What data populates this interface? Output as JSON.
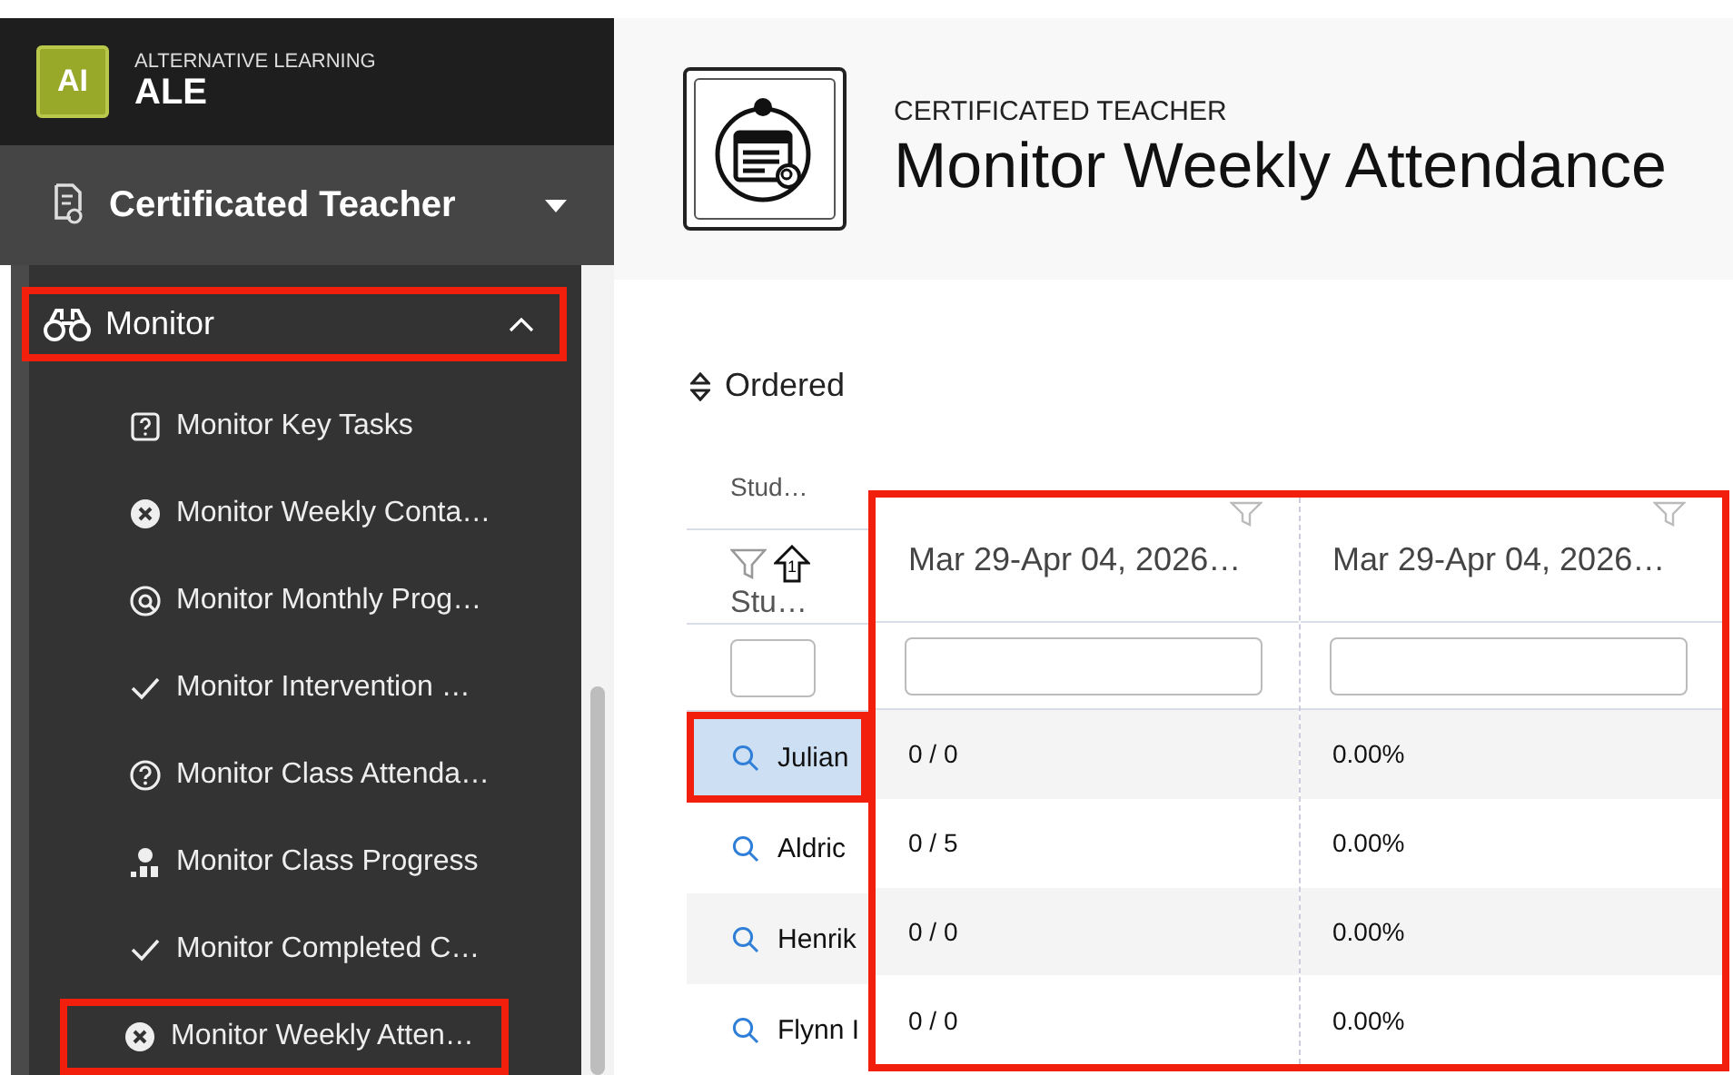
{
  "app": {
    "logo": "AI",
    "subtitle": "ALTERNATIVE LEARNING",
    "name": "ALE"
  },
  "role_menu": {
    "label": "Certificated Teacher"
  },
  "nav": {
    "label": "Monitor",
    "expanded": true,
    "highlighted": true,
    "items": [
      {
        "label": "Monitor Key Tasks",
        "kind": "question-square",
        "highlighted": false
      },
      {
        "label": "Monitor Weekly Conta…",
        "kind": "x-circle",
        "highlighted": false
      },
      {
        "label": "Monitor Monthly Prog…",
        "kind": "search-circle",
        "highlighted": false
      },
      {
        "label": "Monitor Intervention …",
        "kind": "check",
        "highlighted": false
      },
      {
        "label": "Monitor Class Attenda…",
        "kind": "question-circle",
        "highlighted": false
      },
      {
        "label": "Monitor Class Progress",
        "kind": "chart",
        "highlighted": false
      },
      {
        "label": "Monitor Completed C…",
        "kind": "check",
        "highlighted": false
      },
      {
        "label": "Monitor Weekly Atten…",
        "kind": "x-circle",
        "highlighted": true
      }
    ]
  },
  "page": {
    "eyebrow": "CERTIFICATED TEACHER",
    "title": "Monitor Weekly Attendance"
  },
  "sort": {
    "label": "Ordered"
  },
  "table": {
    "student_column": {
      "label": "Stud…",
      "second_label": "Stu…",
      "sort_rank": "1"
    },
    "date_columns": [
      {
        "label": "Mar 29-Apr 04, 2026…"
      },
      {
        "label": "Mar 29-Apr 04, 2026…"
      }
    ],
    "dates_highlighted": true,
    "rows": [
      {
        "student": "Julian",
        "cells": [
          "0 / 0",
          "0.00%"
        ],
        "selected": true,
        "highlighted": true
      },
      {
        "student": "Aldric",
        "cells": [
          "0 / 5",
          "0.00%"
        ],
        "selected": false,
        "highlighted": false
      },
      {
        "student": "Henrik",
        "cells": [
          "0 / 0",
          "0.00%"
        ],
        "selected": false,
        "highlighted": false
      },
      {
        "student": "Flynn I",
        "cells": [
          "0 / 0",
          "0.00%"
        ],
        "selected": false,
        "highlighted": false
      }
    ]
  }
}
